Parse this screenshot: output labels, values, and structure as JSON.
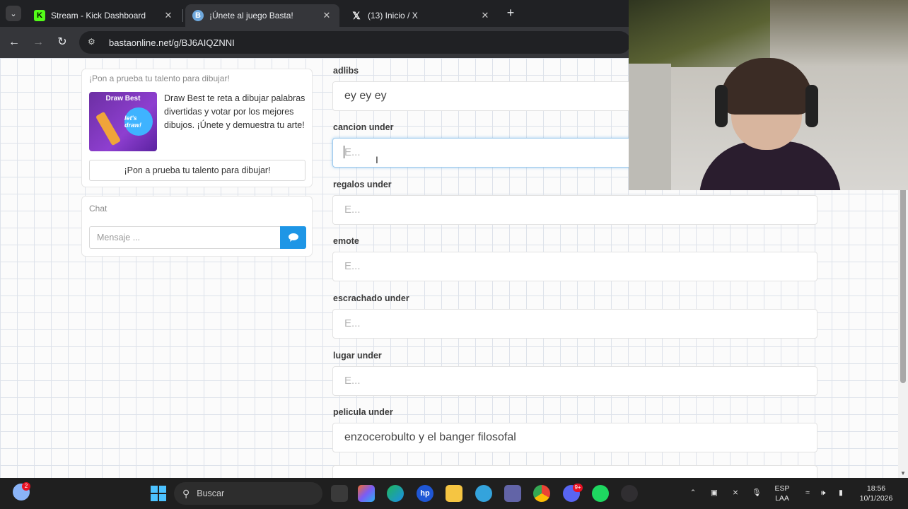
{
  "browser": {
    "tabs": [
      {
        "title": "Stream - Kick Dashboard",
        "icon": "kick-icon",
        "active": false
      },
      {
        "title": "¡Únete al juego Basta!",
        "icon": "basta-icon",
        "active": true
      },
      {
        "title": "(13) Inicio / X",
        "icon": "x-icon",
        "active": false
      }
    ],
    "address": "bastaonline.net/g/BJ6AIQZNNI"
  },
  "promo": {
    "heading": "¡Pon a prueba tu talento para dibujar!",
    "image_title": "Draw Best",
    "image_tag": "let's draw!",
    "text": "Draw Best te reta a dibujar palabras divertidas y votar por los mejores dibujos. ¡Únete y demuestra tu arte!",
    "button_label": "¡Pon a prueba tu talento para dibujar!"
  },
  "chat": {
    "heading": "Chat",
    "placeholder": "Mensaje ..."
  },
  "fields": [
    {
      "label": "adlibs",
      "value": "ey ey ey",
      "placeholder": ""
    },
    {
      "label": "cancion under",
      "value": "",
      "placeholder": "E..."
    },
    {
      "label": "regalos under",
      "value": "",
      "placeholder": "E..."
    },
    {
      "label": "emote",
      "value": "",
      "placeholder": "E..."
    },
    {
      "label": "escrachado under",
      "value": "",
      "placeholder": "E..."
    },
    {
      "label": "lugar under",
      "value": "",
      "placeholder": "E..."
    },
    {
      "label": "pelicula under",
      "value": "enzocerobulto y el banger filosofal",
      "placeholder": ""
    }
  ],
  "taskbar": {
    "search_label": "Buscar",
    "notification_count": "2",
    "discord_badge": "9+",
    "language": "ESP",
    "keyboard": "LAA",
    "time": "18:56",
    "date": "10/1/2026"
  },
  "colors": {
    "accent": "#1e96e6",
    "focus_border": "#9ecaed"
  }
}
